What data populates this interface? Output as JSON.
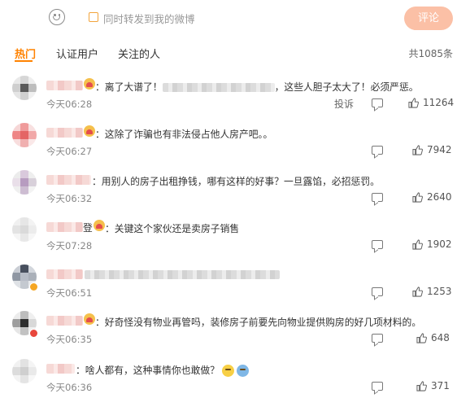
{
  "composer": {
    "repost_label": "同时转发到我的微博",
    "submit_label": "评论"
  },
  "tabs": {
    "items": [
      "热门",
      "认证用户",
      "关注的人"
    ],
    "active": "热门",
    "total_label": "共1085条"
  },
  "colors": {
    "accent": "#ff8200",
    "submit_bg": "#fbc0a6",
    "text": "#333333",
    "muted": "#888888"
  },
  "comments": [
    {
      "text_before": "：离了大谱了！",
      "text_after": "，这些人胆子太大了！必须严惩。",
      "time": "今天06:28",
      "report_label": "投诉",
      "likes": "11264"
    },
    {
      "text": "：这除了诈骗也有非法侵占他人房产吧。。",
      "time": "今天06:27",
      "likes": "7942"
    },
    {
      "text": "：用别人的房子出租挣钱，哪有这样的好事？一旦露馅，必招惩罚。",
      "time": "今天06:32",
      "likes": "2640"
    },
    {
      "nick_fragment": "登",
      "text": "：关键这个家伙还是卖房子销售",
      "time": "今天07:28",
      "likes": "1902"
    },
    {
      "time": "今天06:51",
      "likes": "1253"
    },
    {
      "text": "：好奇怪没有物业再管吗，装修房子前要先向物业提供购房的好几项材料的。",
      "time": "今天06:35",
      "likes": "648"
    },
    {
      "text": "：啥人都有，这种事情你也敢做？",
      "time": "今天06:36",
      "likes": "371"
    }
  ],
  "icons": {
    "emoji": "smiley-face-icon",
    "reply": "comment-reply-icon",
    "like": "thumbs-up-icon"
  }
}
